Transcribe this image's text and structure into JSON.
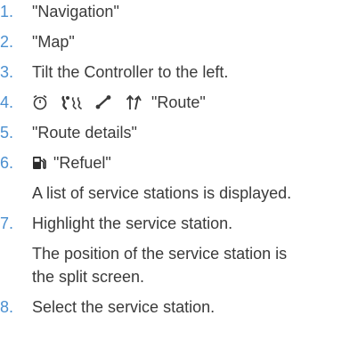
{
  "steps": [
    {
      "num": "1.",
      "text": "\"Navigation\""
    },
    {
      "num": "2.",
      "text": "\"Map\""
    },
    {
      "num": "3.",
      "text": "Tilt the Controller to the left."
    },
    {
      "num": "4.",
      "text": "\"Route\"",
      "icons": [
        "timer-icon",
        "route-preference-icon",
        "route-line-icon",
        "arrows-up-icon"
      ]
    },
    {
      "num": "5.",
      "text": "\"Route details\""
    },
    {
      "num": "6.",
      "text": "\"Refuel\"",
      "icons": [
        "fuel-pump-icon"
      ]
    },
    {
      "note": "A list of service stations is displayed."
    },
    {
      "num": "7.",
      "text": "Highlight the service station."
    },
    {
      "note": "The position of the service station is"
    },
    {
      "note": "the split screen."
    },
    {
      "num": "8.",
      "text": "Select the service station."
    }
  ],
  "colors": {
    "step_number": "#4a8fd0",
    "body_text": "#3a3a3a"
  }
}
